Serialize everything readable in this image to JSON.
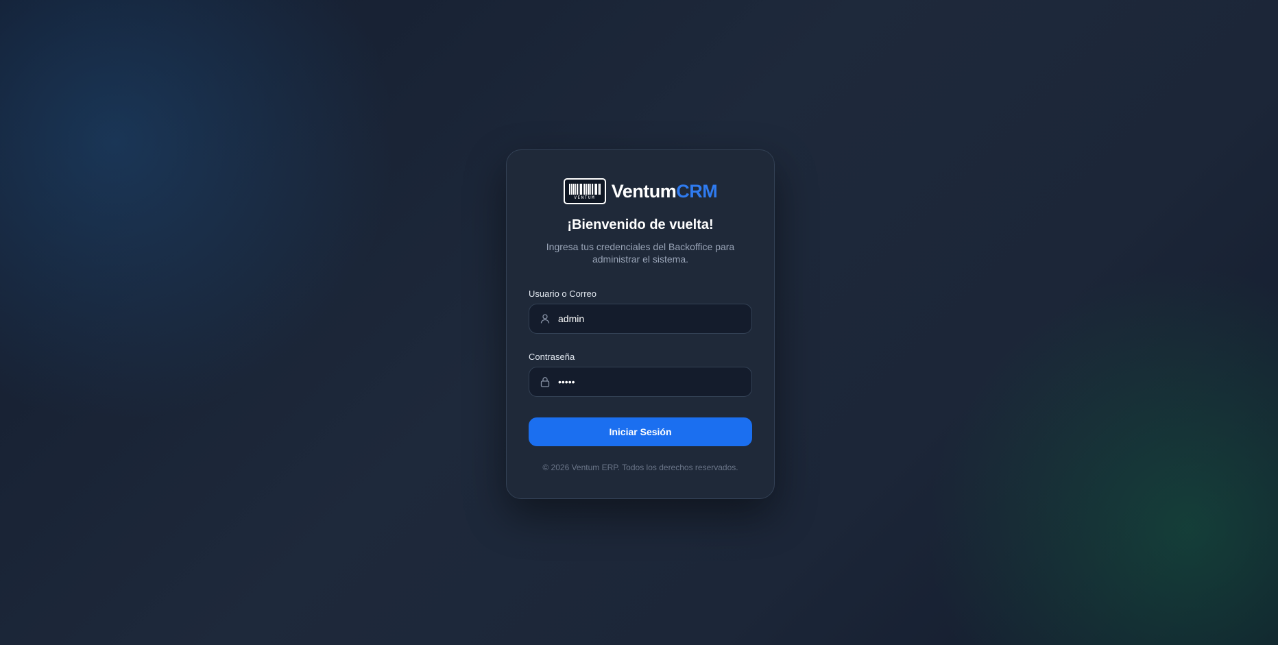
{
  "brand": {
    "logo_text": "VENTUM",
    "name_main": "Ventum",
    "name_accent": "CRM",
    "accent_color": "#2f7bf0"
  },
  "login": {
    "title": "¡Bienvenido de vuelta!",
    "subtitle": "Ingresa tus credenciales del Backoffice para administrar el sistema.",
    "username": {
      "label": "Usuario o Correo",
      "value": "admin",
      "icon": "user-icon"
    },
    "password": {
      "label": "Contraseña",
      "value": "admin",
      "icon": "lock-icon"
    },
    "submit_label": "Iniciar Sesión",
    "button_color": "#1b6ff0"
  },
  "footer": {
    "text": "© 2026 Ventum ERP. Todos los derechos reservados."
  }
}
